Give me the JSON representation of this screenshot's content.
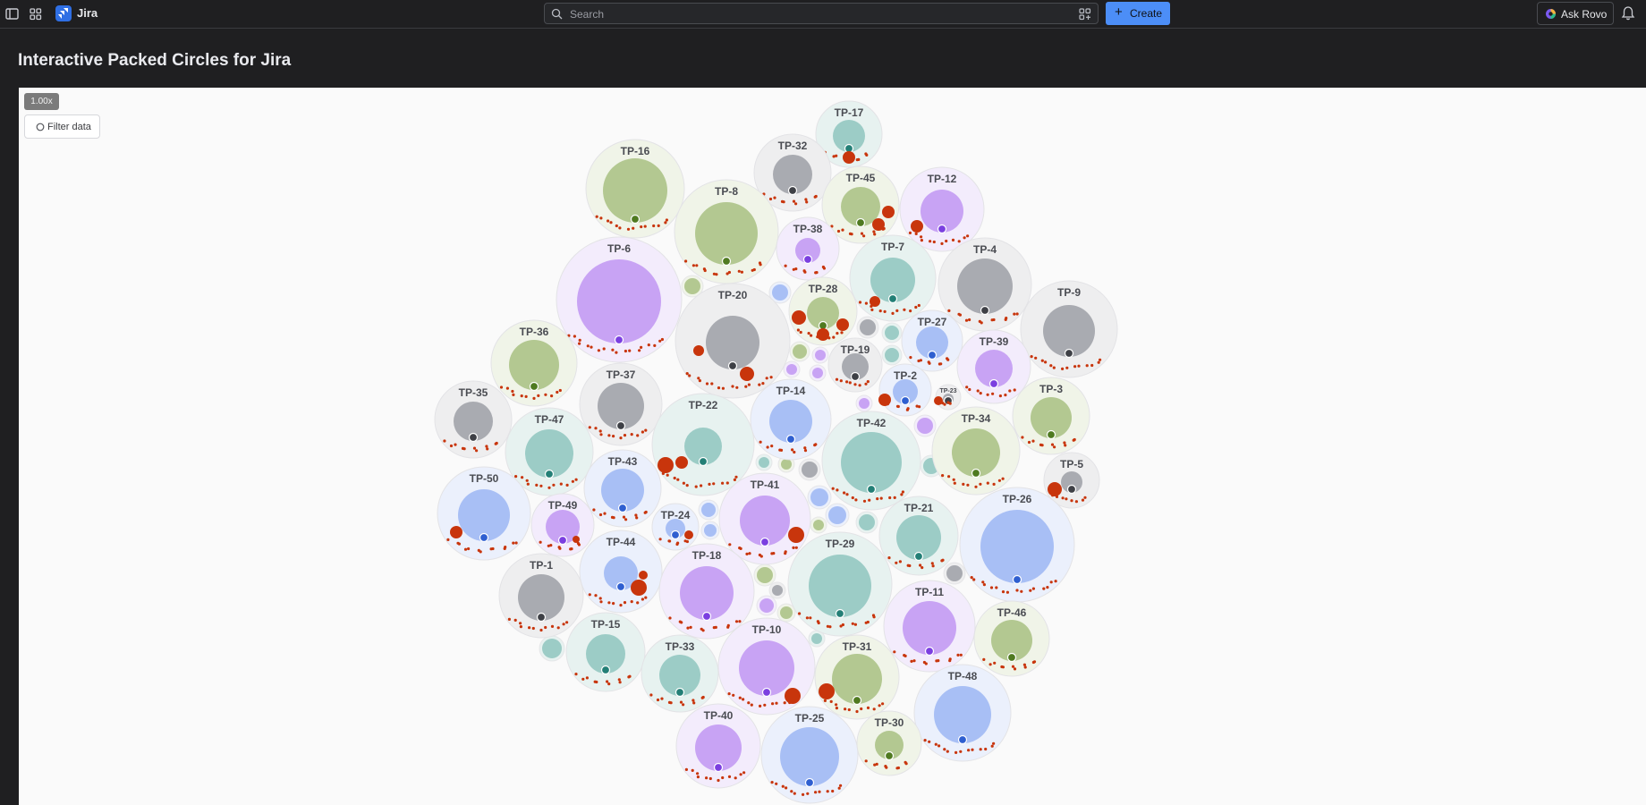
{
  "app": {
    "brand": "Jira",
    "brand_color": "#2f6fe4"
  },
  "topbar": {
    "search_placeholder": "Search",
    "create_label": "Create",
    "ask_rovo_label": "Ask Rovo"
  },
  "page": {
    "title": "Interactive Packed Circles for Jira"
  },
  "toolbar": {
    "zoom_level": "1.00x",
    "filter_label": "Filter data"
  },
  "colors": {
    "accent": "#4c8ef7",
    "purple": "#c8a3f4",
    "green": "#b3c891",
    "teal": "#9cccc6",
    "blue": "#a8bff5",
    "gray": "#a9abb1",
    "red": "#c8350c"
  },
  "chart_data": {
    "type": "packed-circles",
    "items": [
      {
        "id": "TP-17",
        "color": "teal",
        "size": 1
      },
      {
        "id": "TP-32",
        "color": "gray",
        "size": 1
      },
      {
        "id": "TP-16",
        "color": "green",
        "size": 2
      },
      {
        "id": "TP-45",
        "color": "green",
        "size": 1
      },
      {
        "id": "TP-12",
        "color": "purple",
        "size": 1.5
      },
      {
        "id": "TP-8",
        "color": "green",
        "size": 2.5
      },
      {
        "id": "TP-38",
        "color": "purple",
        "size": 0.5
      },
      {
        "id": "TP-6",
        "color": "purple",
        "size": 4
      },
      {
        "id": "TP-7",
        "color": "teal",
        "size": 2
      },
      {
        "id": "TP-4",
        "color": "gray",
        "size": 2
      },
      {
        "id": "TP-9",
        "color": "gray",
        "size": 2
      },
      {
        "id": "TP-28",
        "color": "green",
        "size": 1
      },
      {
        "id": "TP-20",
        "color": "gray",
        "size": 2.5
      },
      {
        "id": "TP-27",
        "color": "blue",
        "size": 1
      },
      {
        "id": "TP-36",
        "color": "green",
        "size": 2
      },
      {
        "id": "TP-19",
        "color": "gray",
        "size": 0.7
      },
      {
        "id": "TP-39",
        "color": "purple",
        "size": 1.3
      },
      {
        "id": "TP-2",
        "color": "blue",
        "size": 0.6
      },
      {
        "id": "TP-23",
        "color": "gray",
        "size": 0.1
      },
      {
        "id": "TP-37",
        "color": "gray",
        "size": 1.8
      },
      {
        "id": "TP-35",
        "color": "gray",
        "size": 1.3
      },
      {
        "id": "TP-14",
        "color": "blue",
        "size": 1.7
      },
      {
        "id": "TP-3",
        "color": "green",
        "size": 1.4
      },
      {
        "id": "TP-22",
        "color": "teal",
        "size": 1.3
      },
      {
        "id": "TP-47",
        "color": "teal",
        "size": 2
      },
      {
        "id": "TP-42",
        "color": "teal",
        "size": 3.3
      },
      {
        "id": "TP-34",
        "color": "green",
        "size": 2
      },
      {
        "id": "TP-5",
        "color": "gray",
        "size": 0.4
      },
      {
        "id": "TP-43",
        "color": "blue",
        "size": 1.7
      },
      {
        "id": "TP-50",
        "color": "blue",
        "size": 2.3
      },
      {
        "id": "TP-41",
        "color": "purple",
        "size": 2.2
      },
      {
        "id": "TP-24",
        "color": "blue",
        "size": 0.4
      },
      {
        "id": "TP-49",
        "color": "purple",
        "size": 1
      },
      {
        "id": "TP-21",
        "color": "teal",
        "size": 1.7
      },
      {
        "id": "TP-26",
        "color": "blue",
        "size": 4.8
      },
      {
        "id": "TP-44",
        "color": "blue",
        "size": 1
      },
      {
        "id": "TP-29",
        "color": "teal",
        "size": 3.5
      },
      {
        "id": "TP-18",
        "color": "purple",
        "size": 2.7
      },
      {
        "id": "TP-1",
        "color": "gray",
        "size": 1.8
      },
      {
        "id": "TP-11",
        "color": "purple",
        "size": 2.6
      },
      {
        "id": "TP-46",
        "color": "green",
        "size": 1.6
      },
      {
        "id": "TP-15",
        "color": "teal",
        "size": 1.4
      },
      {
        "id": "TP-10",
        "color": "purple",
        "size": 2.7
      },
      {
        "id": "TP-33",
        "color": "teal",
        "size": 1.5
      },
      {
        "id": "TP-31",
        "color": "green",
        "size": 2
      },
      {
        "id": "TP-48",
        "color": "blue",
        "size": 2.8
      },
      {
        "id": "TP-40",
        "color": "purple",
        "size": 1.9
      },
      {
        "id": "TP-25",
        "color": "blue",
        "size": 3
      },
      {
        "id": "TP-30",
        "color": "green",
        "size": 0.7
      }
    ]
  }
}
